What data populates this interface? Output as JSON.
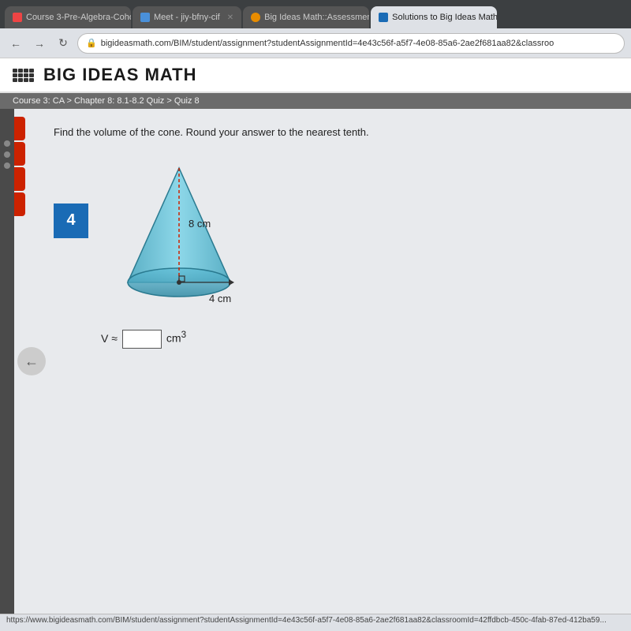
{
  "browser": {
    "tabs": [
      {
        "id": "tab1",
        "label": "Course 3-Pre-Algebra-Coho...",
        "active": false,
        "icon_color": "#e44"
      },
      {
        "id": "tab2",
        "label": "Meet - jiy-bfny-cif",
        "active": false,
        "icon_color": "#4a90d9"
      },
      {
        "id": "tab3",
        "label": "Big Ideas Math::Assessment",
        "active": false,
        "icon_color": "#e88c00"
      },
      {
        "id": "tab4",
        "label": "Solutions to Big Ideas Math",
        "active": true,
        "icon_color": "#1a6bb5"
      }
    ],
    "address": "bigideasmath.com/BIM/student/assignment?studentAssignmentId=4e43c56f-a5f7-4e08-85a6-2ae2f681aa82&classroo"
  },
  "header": {
    "title": "BIG IDEAS MATH"
  },
  "breadcrumb": "Course 3: CA > Chapter 8: 8.1-8.2 Quiz > Quiz 8",
  "question": {
    "number": "4",
    "instruction": "Find the volume of the cone. Round your answer to the nearest tenth.",
    "height_label": "8 cm",
    "radius_label": "4 cm",
    "answer_prefix": "V ≈",
    "answer_unit": "cm",
    "answer_superscript": "3"
  },
  "status_bar": {
    "url": "https://www.bigideasmath.com/BIM/student/assignment?studentAssignmentId=4e43c56f-a5f7-4e08-85a6-2ae2f681aa82&classroomId=42ffdbcb-450c-4fab-87ed-412ba59..."
  }
}
